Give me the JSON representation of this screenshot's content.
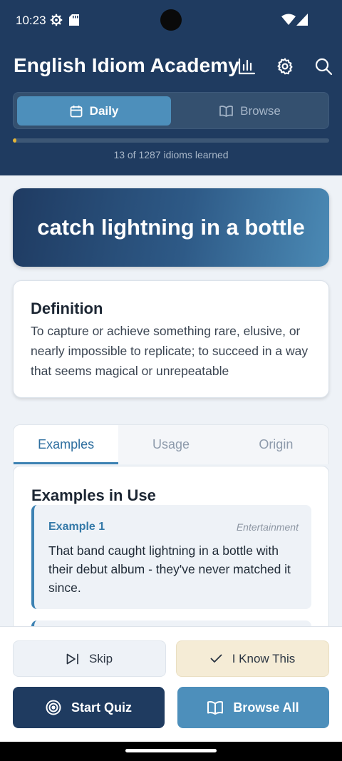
{
  "status": {
    "time": "10:23"
  },
  "header": {
    "title": "English Idiom Academy",
    "icons": [
      "bar-chart-icon",
      "gear-icon",
      "search-icon"
    ]
  },
  "mode_toggle": {
    "daily_label": "Daily",
    "browse_label": "Browse",
    "selected": "Daily"
  },
  "progress": {
    "learned": 13,
    "total": 1287,
    "text": "13 of 1287 idioms learned"
  },
  "idiom": {
    "phrase": "catch lightning in a bottle",
    "definition_title": "Definition",
    "definition": "To capture or achieve something rare, elusive, or nearly impossible to replicate; to succeed in a way that seems magical or unrepeatable"
  },
  "tabs": [
    {
      "label": "Examples",
      "active": true
    },
    {
      "label": "Usage",
      "active": false
    },
    {
      "label": "Origin",
      "active": false
    }
  ],
  "examples": {
    "heading": "Examples in Use",
    "items": [
      {
        "label": "Example 1",
        "category": "Entertainment",
        "text": "That band caught lightning in a bottle with their debut album - they've never matched it since."
      }
    ]
  },
  "actions": {
    "skip_label": "Skip",
    "know_label": "I Know This",
    "quiz_label": "Start Quiz",
    "browse_all_label": "Browse All"
  },
  "colors": {
    "header_bg": "#1f3b60",
    "accent": "#4d8fbb",
    "progress_fill": "#e3b437",
    "know_bg": "#f5ecd6"
  }
}
